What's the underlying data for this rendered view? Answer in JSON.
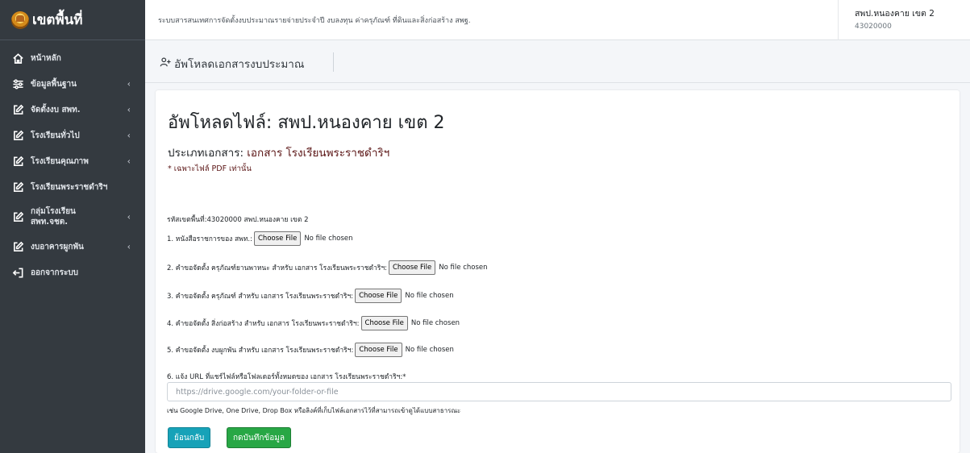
{
  "brand": {
    "text": "เขตพื้นที่"
  },
  "sidebar": {
    "items": [
      {
        "label": "หน้าหลัก",
        "icon": "home-icon",
        "chevron": ""
      },
      {
        "label": "ข้อมูลพื้นฐาน",
        "icon": "sliders-icon",
        "chevron": "‹"
      },
      {
        "label": "จัดตั้งงบ สพท.",
        "icon": "edit-icon",
        "chevron": "‹"
      },
      {
        "label": "โรงเรียนทั่วไป",
        "icon": "edit-icon",
        "chevron": "‹"
      },
      {
        "label": "โรงเรียนคุณภาพ",
        "icon": "edit-icon",
        "chevron": "‹"
      },
      {
        "label": "โรงเรียนพระราชดำริฯ",
        "icon": "edit-icon",
        "chevron": ""
      },
      {
        "label_line1": "กลุ่มโรงเรียน",
        "label_line2": "สพท.จชต.",
        "icon": "edit-icon",
        "chevron": "‹"
      },
      {
        "label": "งบอาคารผูกพัน",
        "icon": "edit-icon",
        "chevron": "‹"
      },
      {
        "label": "ออกจากระบบ",
        "icon": "logout-icon",
        "chevron": ""
      }
    ]
  },
  "topbar": {
    "system_title": "ระบบสารสนเทศการจัดตั้งงบประมาณรายจ่ายประจำปี งบลงทุน ค่าครุภัณฑ์ ที่ดินและสิ่งก่อสร้าง สพฐ.",
    "user_name": "สพป.หนองคาย เขต 2",
    "user_code": "43020000"
  },
  "header": {
    "title": "อัพโหลดเอกสารงบประมาณ",
    "icon": "user-plus-icon"
  },
  "main": {
    "page_title": "อัพโหลดไฟล์: สพป.หนองคาย เขต 2",
    "doc_type_prefix": "ประเภทเอกสาร: ",
    "doc_type_name": "เอกสาร โรงเรียนพระราชดำริฯ",
    "pdf_note": "* เฉพาะไฟล์ PDF เท่านั้น",
    "area_code": "รหัสเขตพื้นที่:43020000 สพป.หนองคาย เขต 2",
    "uploads": [
      {
        "label": "1. หนังสือราชการของ สพท.:",
        "button": "Choose File",
        "status": "No file chosen"
      },
      {
        "label": "2. คำขอจัดตั้ง ครุภัณฑ์ยานพาหนะ สำหรับ เอกสาร โรงเรียนพระราชดำริฯ:",
        "button": "Choose File",
        "status": "No file chosen"
      },
      {
        "label": "3. คำขอจัดตั้ง ครุภัณฑ์ สำหรับ เอกสาร โรงเรียนพระราชดำริฯ:",
        "button": "Choose File",
        "status": "No file chosen"
      },
      {
        "label": "4. คำขอจัดตั้ง สิ่งก่อสร้าง สำหรับ เอกสาร โรงเรียนพระราชดำริฯ:",
        "button": "Choose File",
        "status": "No file chosen"
      },
      {
        "label": "5. คำขอจัดตั้ง งบผูกพัน สำหรับ เอกสาร โรงเรียนพระราชดำริฯ:",
        "button": "Choose File",
        "status": "No file chosen"
      }
    ],
    "url_label": "6. แจ้ง URL ที่แชร์ไฟล์หรือโฟลเดอร์ทั้งหมดของ เอกสาร โรงเรียนพระราชดำริฯ:*",
    "url_placeholder": "https://drive.google.com/your-folder-or-file",
    "url_help": "เช่น Google Drive, One Drive, Drop Box หรือลิงค์ที่เก็บไฟล์เอกสารไว้ที่สามารถเข้าดูได้แบบสาธารณะ",
    "back_button": "ย้อนกลับ",
    "save_button": "กดบันทึกข้อมูล"
  },
  "colors": {
    "sidebar_bg": "#343a40",
    "doc_name": "#5a1414",
    "back_button": "#17a2b8",
    "save_button": "#28a745"
  }
}
